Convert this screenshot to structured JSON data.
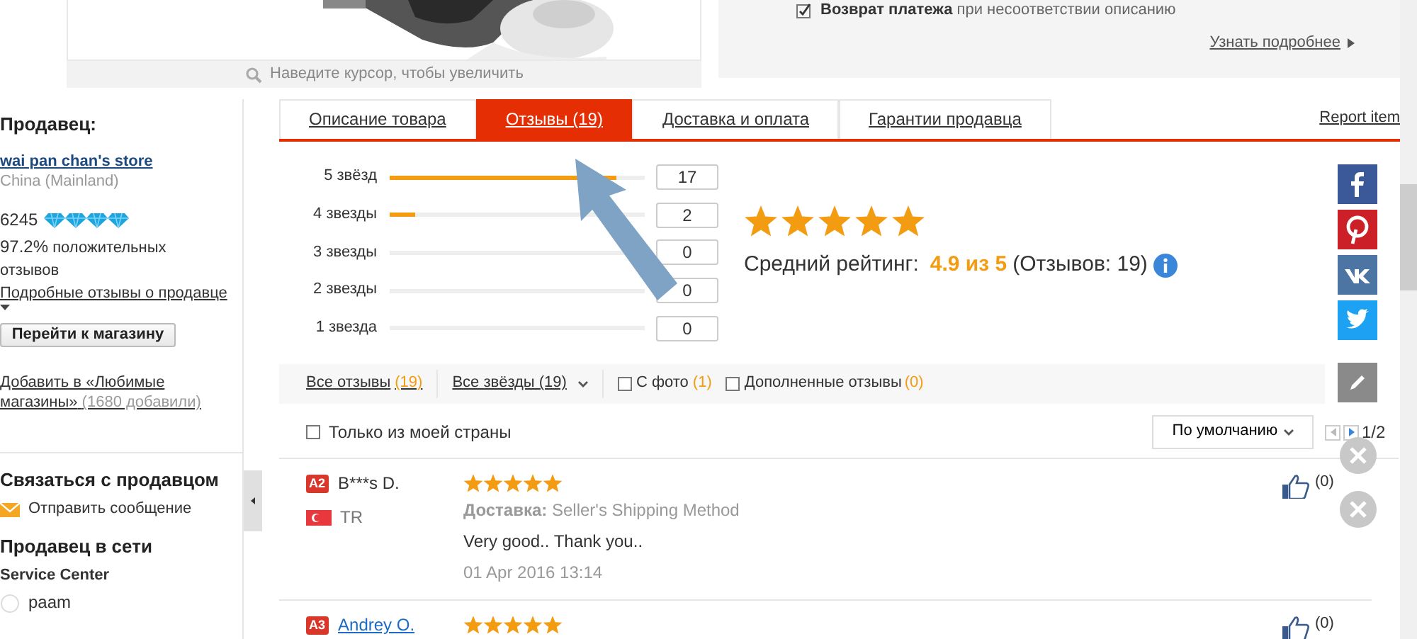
{
  "product_image": {
    "kind": "picture",
    "hint": "Наведите курсор, чтобы увеличить"
  },
  "protection": {
    "checked": true,
    "text": "**Возврат платежа** при несоответствии описанию",
    "more": "Узнать подробнее"
  },
  "seller": {
    "heading": "Продавец:",
    "store": "wai pan chan's store",
    "country": "China (Mainland)",
    "score": "6245",
    "positive": "97.2%",
    "positive_label": "положительных отзывов",
    "detail_link": "Подробные отзывы о продавце",
    "store_button": "Перейти к магазину",
    "favorite": "Добавить в «Любимые магазины»",
    "favorite_count": "(1680 добавили)"
  },
  "contact": {
    "heading": "Связаться с продавцом",
    "message": "Отправить сообщение"
  },
  "online": {
    "heading": "Продавец в сети",
    "group": "Service Center",
    "agent": "paam"
  },
  "tabs": [
    {
      "label": "Описание товара",
      "selected": false
    },
    {
      "label": "Отзывы (19)",
      "selected": true
    },
    {
      "label": "Доставка и оплата",
      "selected": false
    },
    {
      "label": "Гарантии продавца",
      "selected": false
    }
  ],
  "report": "Report item",
  "histogram": [
    {
      "label": "5 звёзд",
      "level": 0.89,
      "count": "17"
    },
    {
      "label": "4 звезды",
      "level": 0.1,
      "count": "2"
    },
    {
      "label": "3 звезды",
      "level": 0,
      "count": "0"
    },
    {
      "label": "2 звезды",
      "level": 0,
      "count": "0"
    },
    {
      "label": "1 звезда",
      "level": 0,
      "count": "0"
    }
  ],
  "summary": {
    "stars": 5,
    "label": "Средний рейтинг:",
    "score": "4.9 из 5",
    "count": "(Отзывов: 19)"
  },
  "filters": [
    {
      "kind": "link",
      "label": "Все отзывы",
      "count": "(19)"
    },
    {
      "kind": "dropdown",
      "label": "Все звёзды (19)"
    },
    {
      "kind": "checkbox",
      "label": "С фото",
      "count": "(1)",
      "checked": false
    },
    {
      "kind": "checkbox",
      "label": "Дополненные отзывы",
      "count": "(0)",
      "checked": false
    }
  ],
  "country_only": {
    "label": "Только из моей страны",
    "checked": false
  },
  "sort": "По умолчанию",
  "pager": "1/2",
  "reviews": [
    {
      "badge": "A2",
      "name": "B***s D.",
      "is_link": false,
      "country": "TR",
      "stars": 5,
      "delivery_label": "Доставка:",
      "delivery": "Seller's Shipping Method",
      "text": "Very good.. Thank you..",
      "date": "01 Apr 2016 13:14",
      "likes": "(0)"
    },
    {
      "badge": "A3",
      "name": "Andrey O.",
      "is_link": true,
      "stars": 5,
      "likes": "(0)"
    }
  ]
}
